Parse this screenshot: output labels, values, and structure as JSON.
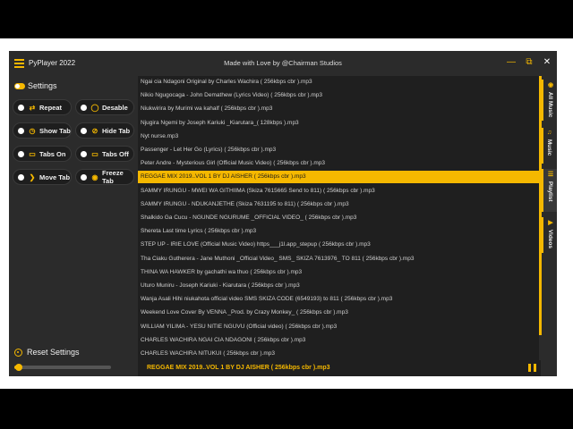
{
  "window": {
    "title": "PyPlayer 2022",
    "subtitle": "Made with Love by @Chairman Studios",
    "accent_color": "#f5b800",
    "controls": [
      "minimize-icon",
      "restore-icon",
      "close-icon"
    ]
  },
  "sidebar": {
    "heading": "Settings",
    "buttons": [
      {
        "label": "Repeat",
        "icon": "repeat-icon"
      },
      {
        "label": "Desable",
        "icon": "toggle-icon"
      },
      {
        "label": "Show Tab",
        "icon": "show-tab-icon"
      },
      {
        "label": "Hide Tab",
        "icon": "hide-tab-icon"
      },
      {
        "label": "Tabs On",
        "icon": "tabs-on-icon"
      },
      {
        "label": "Tabs Off",
        "icon": "tabs-off-icon"
      },
      {
        "label": "Move Tab",
        "icon": "chevron-right-icon"
      },
      {
        "label": "Freeze Tab",
        "icon": "freeze-icon"
      }
    ],
    "reset_label": "Reset Settings",
    "volume_level": 0.05
  },
  "playlist": {
    "selected_index": 7,
    "items": [
      "Ngai cia Ndagoni Original by Charles Wachira ( 256kbps cbr ).mp3",
      "Nikio Ngugocaga - John Demathew (Lyrics Video) ( 256kbps cbr ).mp3",
      "Niukwirira by Murimi wa kahalf ( 256kbps cbr ).mp3",
      "Njugira Ngemi by Joseph Kariuki _Kiarutara_( 128kbps ).mp3",
      "Nyt nurse.mp3",
      "Passenger - Let Her Go (Lyrics) ( 256kbps cbr ).mp3",
      "Peter Andre - Mysterious Girl (Official Music Video) ( 256kbps cbr ).mp3",
      "REGGAE MIX 2019..VOL 1 BY DJ AISHER ( 256kbps cbr ).mp3",
      "SAMMY IRUNGU - MWEI WA GITHIIMA (Skiza 7615665 Send to 811) ( 256kbps cbr ).mp3",
      "SAMMY IRUNGU - NDUKANJETHE (Skiza 7631195 to 811) ( 256kbps cbr ).mp3",
      "Shalkido Ga Cucu - NGUNDE NGURUME _OFFICIAL VIDEO_ ( 256kbps cbr ).mp3",
      "Shereta Last time Lyrics ( 256kbps cbr ).mp3",
      "STEP UP - IRIE LOVE (Official Music Video) https___j1l.app_stepup ( 256kbps cbr ).mp3",
      "Tha Ciaku Gutherera - Jane Muthoni _Official Video_ SMS_ SKIZA 7613976_ TO 811 ( 256kbps cbr ).mp3",
      "THINA WA HAWKER by gachathi wa thuo ( 256kbps cbr ).mp3",
      "Uturo Muniru - Joseph Kariuki - Kiarutara ( 256kbps cbr ).mp3",
      "Wanja Asali Hihi niukahota official video SMS SKIZA CODE (6549193) to 811 ( 256kbps cbr ).mp3",
      "Weekend Love Cover By VENNA _Prod. by Crazy Monkey_ ( 256kbps cbr ).mp3",
      "WILLIAM YILIMA - YESU NITIE NGUVU (Official video) ( 256kbps cbr ).mp3",
      "CHARLES WACHIRA NGAI CIA NDAGONI ( 256kbps cbr ).mp3",
      "CHARLES WACHIRA NITUKUI ( 256kbps cbr ).mp3"
    ]
  },
  "now_playing": {
    "title": "REGGAE MIX 2019..VOL 1 BY DJ AISHER ( 256kbps cbr ).mp3",
    "control_icon": "pause-icon"
  },
  "right_tabs": [
    {
      "label": "All Music",
      "icon": "disc-icon"
    },
    {
      "label": "Music",
      "icon": "music-note-icon"
    },
    {
      "label": "Playlist",
      "icon": "playlist-icon"
    },
    {
      "label": "Videos",
      "icon": "video-icon"
    }
  ],
  "active_right_tab": 2
}
